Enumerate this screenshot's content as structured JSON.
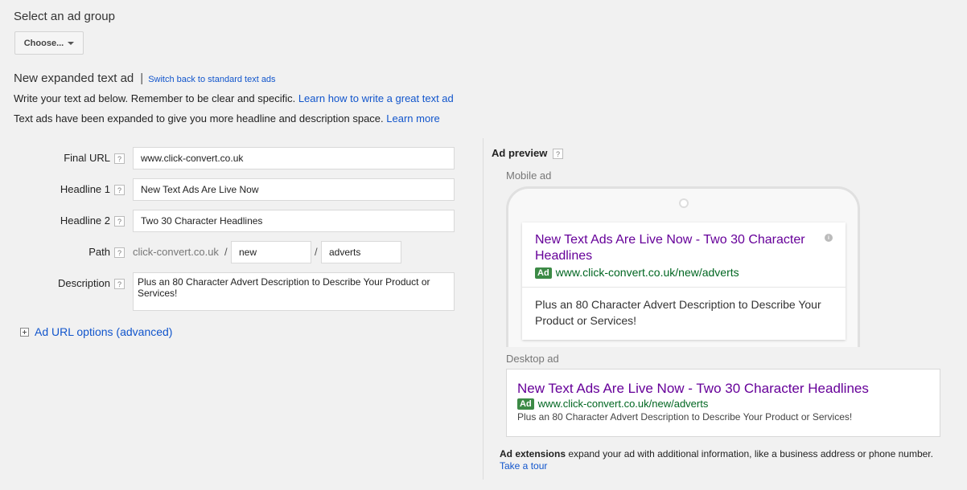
{
  "ad_group": {
    "title": "Select an ad group",
    "choose_label": "Choose..."
  },
  "section": {
    "title": "New expanded text ad",
    "separator": "|",
    "switch_link": "Switch back to standard text ads",
    "info1_text": "Write your text ad below. Remember to be clear and specific.",
    "info1_link": "Learn how to write a great text ad",
    "info2_text": "Text ads have been expanded to give you more headline and description space.",
    "info2_link": "Learn more"
  },
  "form": {
    "help_glyph": "?",
    "final_url_label": "Final URL",
    "final_url_value": "www.click-convert.co.uk",
    "headline1_label": "Headline 1",
    "headline1_value": "New Text Ads Are Live Now",
    "headline2_label": "Headline 2",
    "headline2_value": "Two 30 Character Headlines",
    "path_label": "Path",
    "path_prefix": "click-convert.co.uk",
    "path_slash": "/",
    "path1_value": "new",
    "path2_value": "adverts",
    "description_label": "Description",
    "description_value": "Plus an 80 Character Advert Description to Describe Your Product or Services!",
    "url_options_link": "Ad URL options (advanced)"
  },
  "preview": {
    "title": "Ad preview",
    "mobile_label": "Mobile ad",
    "desktop_label": "Desktop ad",
    "ad_badge": "Ad",
    "headline_full": "New Text Ads Are Live Now - Two 30 Character Headlines",
    "display_url": "www.click-convert.co.uk/new/adverts",
    "description": "Plus an 80 Character Advert Description to Describe Your Product or Services!",
    "info_glyph": "i"
  },
  "extensions": {
    "bold": "Ad extensions",
    "text": " expand your ad with additional information, like a business address or phone number.",
    "link": "Take a tour"
  },
  "colors": {
    "link": "#1155cc",
    "headline": "#660099",
    "url_green": "#006621",
    "badge_green": "#3c8a46"
  }
}
